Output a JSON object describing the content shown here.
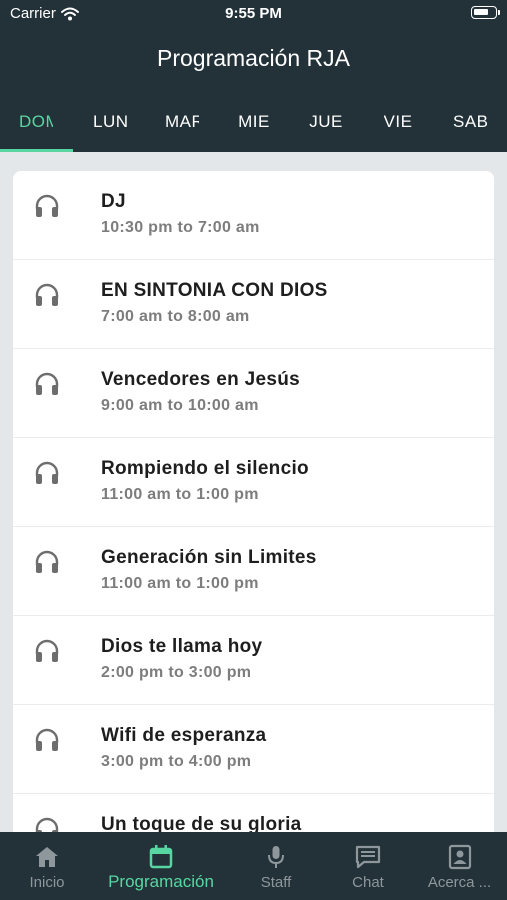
{
  "status_bar": {
    "carrier": "Carrier",
    "time": "9:55 PM",
    "battery_level": 0.7
  },
  "header": {
    "title": "Programación RJA"
  },
  "tabs": [
    {
      "label": "DOM",
      "active": true
    },
    {
      "label": "LUN",
      "active": false
    },
    {
      "label": "MAR",
      "active": false
    },
    {
      "label": "MIE",
      "active": false
    },
    {
      "label": "JUE",
      "active": false
    },
    {
      "label": "VIE",
      "active": false
    },
    {
      "label": "SAB",
      "active": false
    }
  ],
  "programs": [
    {
      "name": "DJ",
      "hours": "10:30 pm to 7:00 am",
      "icon": "headphones-icon"
    },
    {
      "name": "EN SINTONIA CON DIOS",
      "hours": "7:00 am to 8:00 am",
      "icon": "headphones-icon"
    },
    {
      "name": "Vencedores en Jesús",
      "hours": "9:00 am to 10:00 am",
      "icon": "headphones-icon"
    },
    {
      "name": "Rompiendo el silencio",
      "hours": "11:00 am to 1:00 pm",
      "icon": "headphones-icon"
    },
    {
      "name": "Generación sin Limites",
      "hours": "11:00 am to 1:00 pm",
      "icon": "headphones-icon"
    },
    {
      "name": "Dios te llama hoy",
      "hours": "2:00 pm to 3:00 pm",
      "icon": "headphones-icon"
    },
    {
      "name": "Wifi de esperanza",
      "hours": "3:00 pm to 4:00 pm",
      "icon": "headphones-icon"
    },
    {
      "name": "Un toque de su gloria",
      "hours": "",
      "icon": "headphones-icon"
    }
  ],
  "tabbar": [
    {
      "label": "Inicio",
      "icon": "home-icon",
      "active": false
    },
    {
      "label": "Programación",
      "icon": "calendar-icon",
      "active": true
    },
    {
      "label": "Staff",
      "icon": "microphone-icon",
      "active": false
    },
    {
      "label": "Chat",
      "icon": "chat-icon",
      "active": false
    },
    {
      "label": "Acerca ...",
      "icon": "contact-card-icon",
      "active": false
    }
  ],
  "colors": {
    "header_bg": "#233238",
    "accent": "#58d6a2",
    "background": "#e4e7ea",
    "tabbar_inactive": "#8e979b"
  }
}
